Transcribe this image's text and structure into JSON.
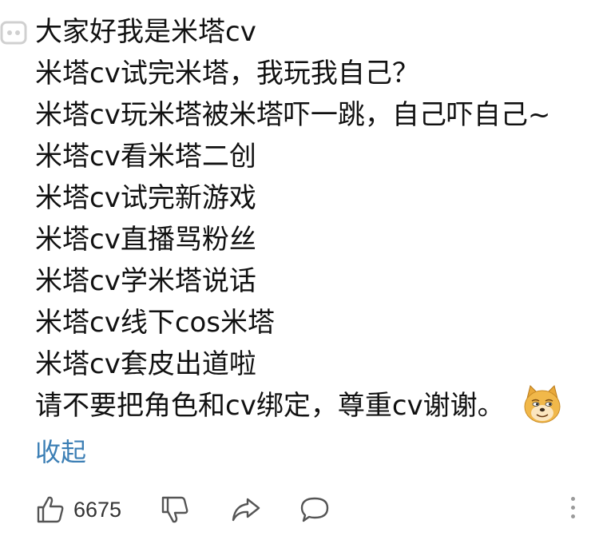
{
  "comment": {
    "lines": [
      "大家好我是米塔cv",
      "米塔cv试完米塔，我玩我自己？",
      "米塔cv玩米塔被米塔吓一跳，自己吓自己~",
      "米塔cv看米塔二创",
      "米塔cv试完新游戏",
      "米塔cv直播骂粉丝",
      "米塔cv学米塔说话",
      "米塔cv线下cos米塔",
      "米塔cv套皮出道啦",
      "请不要把角色和cv绑定，尊重cv谢谢。"
    ],
    "emoji": "doge-emoji",
    "collapse_label": "收起"
  },
  "actions": {
    "like_count": "6675",
    "like_icon": "thumbs-up-icon",
    "dislike_icon": "thumbs-down-icon",
    "share_icon": "share-icon",
    "reply_icon": "comment-icon",
    "more_icon": "more-vertical-icon"
  },
  "colors": {
    "text": "#111111",
    "link": "#3c7fb5",
    "icon": "#555555"
  }
}
